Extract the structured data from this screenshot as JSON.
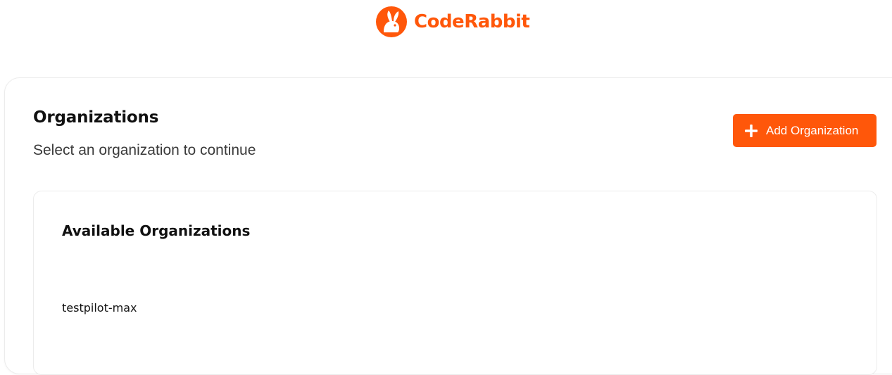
{
  "brand": {
    "name": "CodeRabbit",
    "logo_icon": "rabbit-logo-icon",
    "accent_color": "#ff570a"
  },
  "header": {
    "title": "Organizations",
    "subtitle": "Select an organization to continue"
  },
  "actions": {
    "add_organization_label": "Add Organization",
    "add_organization_icon": "plus-icon"
  },
  "available": {
    "title": "Available Organizations",
    "organizations": [
      {
        "name": "testpilot-max"
      }
    ]
  }
}
